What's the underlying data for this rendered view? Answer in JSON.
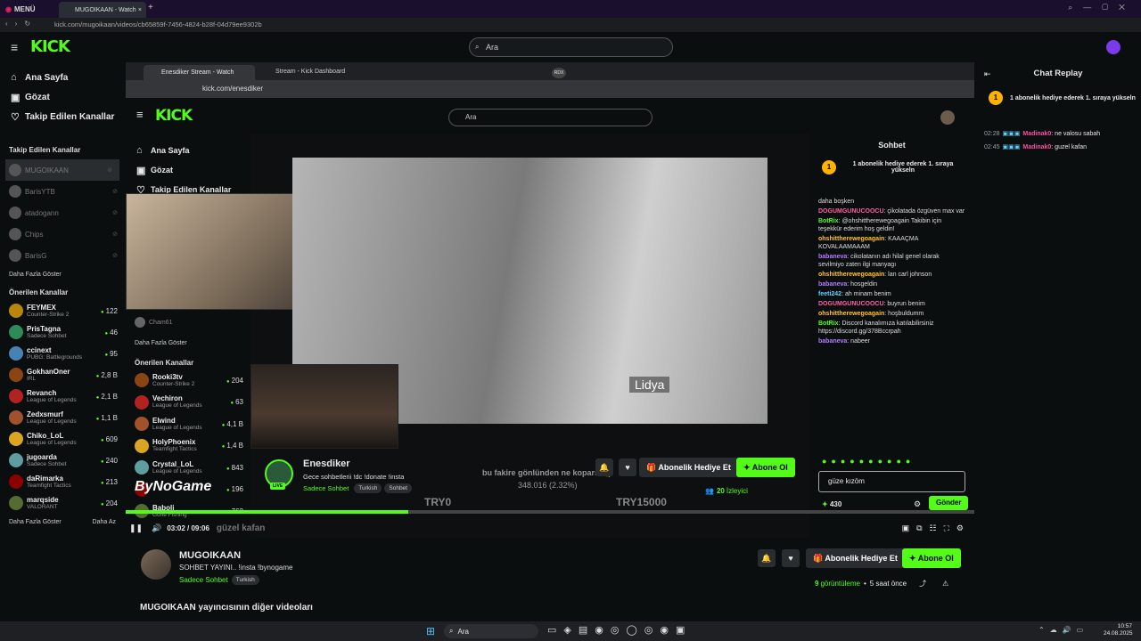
{
  "browser": {
    "menu_label": "MENÜ",
    "tab_title": "MUGOIKAAN - Watch",
    "url": "kick.com/mugoikaan/videos/cb65859f-7456-4824-b28f-04d79ee9302b"
  },
  "header": {
    "logo": "KICK",
    "search_placeholder": "Ara"
  },
  "sidebar": {
    "nav": [
      {
        "label": "Ana Sayfa",
        "icon": "home-icon"
      },
      {
        "label": "Gözat",
        "icon": "browse-icon"
      },
      {
        "label": "Takip Edilen Kanallar",
        "icon": "heart-icon"
      }
    ],
    "followed_title": "Takip Edilen Kanallar",
    "followed": [
      {
        "name": "MUGOIKAAN"
      },
      {
        "name": "BarisYTB"
      },
      {
        "name": "atadogann"
      },
      {
        "name": "Chips"
      },
      {
        "name": "BarisG"
      }
    ],
    "show_more": "Daha Fazla Göster",
    "recommended_title": "Önerilen Kanallar",
    "recommended": [
      {
        "name": "FEYMEX",
        "game": "Counter-Strike 2",
        "viewers": "122"
      },
      {
        "name": "PrisTagna",
        "game": "Sadece Sohbet",
        "viewers": "46"
      },
      {
        "name": "ccinext",
        "game": "PUBG: Battlegrounds",
        "viewers": "95"
      },
      {
        "name": "GokhanOner",
        "game": "IRL",
        "viewers": "2,8 B"
      },
      {
        "name": "Revanch",
        "game": "League of Legends",
        "viewers": "2,1 B"
      },
      {
        "name": "Zedxsmurf",
        "game": "League of Legends",
        "viewers": "1,1 B"
      },
      {
        "name": "Chiko_LoL",
        "game": "League of Legends",
        "viewers": "609"
      },
      {
        "name": "jugoarda",
        "game": "Sadece Sohbet",
        "viewers": "240"
      },
      {
        "name": "daRimarka",
        "game": "Teamfight Tactics",
        "viewers": "213"
      },
      {
        "name": "marqside",
        "game": "VALORANT",
        "viewers": "204"
      }
    ],
    "footer_left": "Daha Fazla Göster",
    "footer_right": "Daha Az"
  },
  "inner": {
    "tabs": [
      "Enesdiker Stream - Watch",
      "Stream - Kick Dashboard"
    ],
    "url": "kick.com/enesdiker",
    "sidebar_nav": [
      "Ana Sayfa",
      "Gözat",
      "Takip Edilen Kanallar"
    ],
    "sidebar_channel": "Cham61",
    "show_more": "Daha Fazla Göster",
    "recommended_title": "Önerilen Kanallar",
    "recommended": [
      {
        "name": "Rooki3tv",
        "game": "Counter-Strike 2",
        "viewers": "204"
      },
      {
        "name": "Vechiron",
        "game": "League of Legends",
        "viewers": "63"
      },
      {
        "name": "Elwind",
        "game": "League of Legends",
        "viewers": "4,1 B"
      },
      {
        "name": "HolyPhoenix",
        "game": "Teamfight Tactics",
        "viewers": "1,4 B"
      },
      {
        "name": "Crystal_LoL",
        "game": "League of Legends",
        "viewers": "843"
      },
      {
        "name": "",
        "game": "",
        "viewers": "196"
      },
      {
        "name": "Baboli",
        "game": "Gone Fishing",
        "viewers": "762"
      }
    ],
    "watermark": "ByNoGame",
    "video_caption": "Lidya",
    "streamer": "Enesdiker",
    "stream_title": "Gece sohbetlerii !dc !donate !insta",
    "category": "Sadece Sohbet",
    "tags": [
      "Turkish",
      "Sohbet"
    ],
    "live": "LIVE",
    "donation_text": "bu fakire gönlünden ne koparsa ;)",
    "donation_progress": "348.016 (2.32%)",
    "donation_min": "TRY0",
    "donation_max": "TRY15000",
    "gift_button": "Abonelik Hediye Et",
    "follow_button": "Abone Ol",
    "viewers": "20",
    "viewers_label": "İzleyici",
    "chat": {
      "title": "Sohbet",
      "pinned": "1 abonelik hediye ederek 1. sıraya yükseln",
      "messages": [
        {
          "user": "",
          "text": "daha boşken",
          "color": "#ddd"
        },
        {
          "user": "DOGUMGUNUCOOCU",
          "text": ": çikolatada özgüven max var",
          "color": "#ff5fa2"
        },
        {
          "user": "BotRix",
          "text": ": @ohshittherewegoagain Takibin için teşekkür ederim hoş geldin!",
          "color": "#53fc18"
        },
        {
          "user": "ohshittherewegoagain",
          "text": ": KAAAÇMA KOVALAAMAAAM",
          "color": "#ffc233"
        },
        {
          "user": "babaneva",
          "text": ": cikolatanın adı hilal genel olarak sevilmiyo zaten ilgi manyagı",
          "color": "#b57bff"
        },
        {
          "user": "ohshittherewegoagain",
          "text": ": lan carl johnson",
          "color": "#ffc233"
        },
        {
          "user": "babaneva",
          "text": ": hosgeldin",
          "color": "#b57bff"
        },
        {
          "user": "feeti242",
          "text": ": ah minam benim",
          "color": "#5fd3ff"
        },
        {
          "user": "DOGUMGUNUCOOCU",
          "text": ": buyrun benim",
          "color": "#ff5fa2"
        },
        {
          "user": "ohshittherewegoagain",
          "text": ": hoşbuldumm",
          "color": "#ffc233"
        },
        {
          "user": "BotRix",
          "text": ": Discord kanalımıza katılabilirsiniz https://discord.gg/378Bccrpah",
          "color": "#53fc18"
        },
        {
          "user": "babaneva",
          "text": ": nabeer",
          "color": "#b57bff"
        }
      ],
      "input_value": "güze kızöm",
      "points": "430",
      "send": "Gönder"
    }
  },
  "player": {
    "time": "03:02 / 09:06",
    "subtitle": "güzel kafan",
    "progress": 0.333
  },
  "video_info": {
    "channel": "MUGOIKAAN",
    "title": "SOHBET YAYINI.. !insta !bynogame",
    "category": "Sadece Sohbet",
    "tag": "Turkish",
    "gift_button": "Abonelik Hediye Et",
    "follow_button": "Abone Ol",
    "views": "9",
    "views_label": "görüntüleme",
    "ago": "5 saat önce",
    "more_videos": "MUGOIKAAN yayıncısının diğer videoları"
  },
  "replay": {
    "title": "Chat Replay",
    "pinned": "1 abonelik hediye ederek 1. sıraya yükseln",
    "messages": [
      {
        "time": "02:28",
        "user": "Madinak0",
        "text": ": ne valosu sabah"
      },
      {
        "time": "02:45",
        "user": "Madinak0",
        "text": ": guzel kafan"
      }
    ]
  },
  "taskbar": {
    "search": "Ara",
    "time": "10:57",
    "date": "24.08.2025"
  }
}
